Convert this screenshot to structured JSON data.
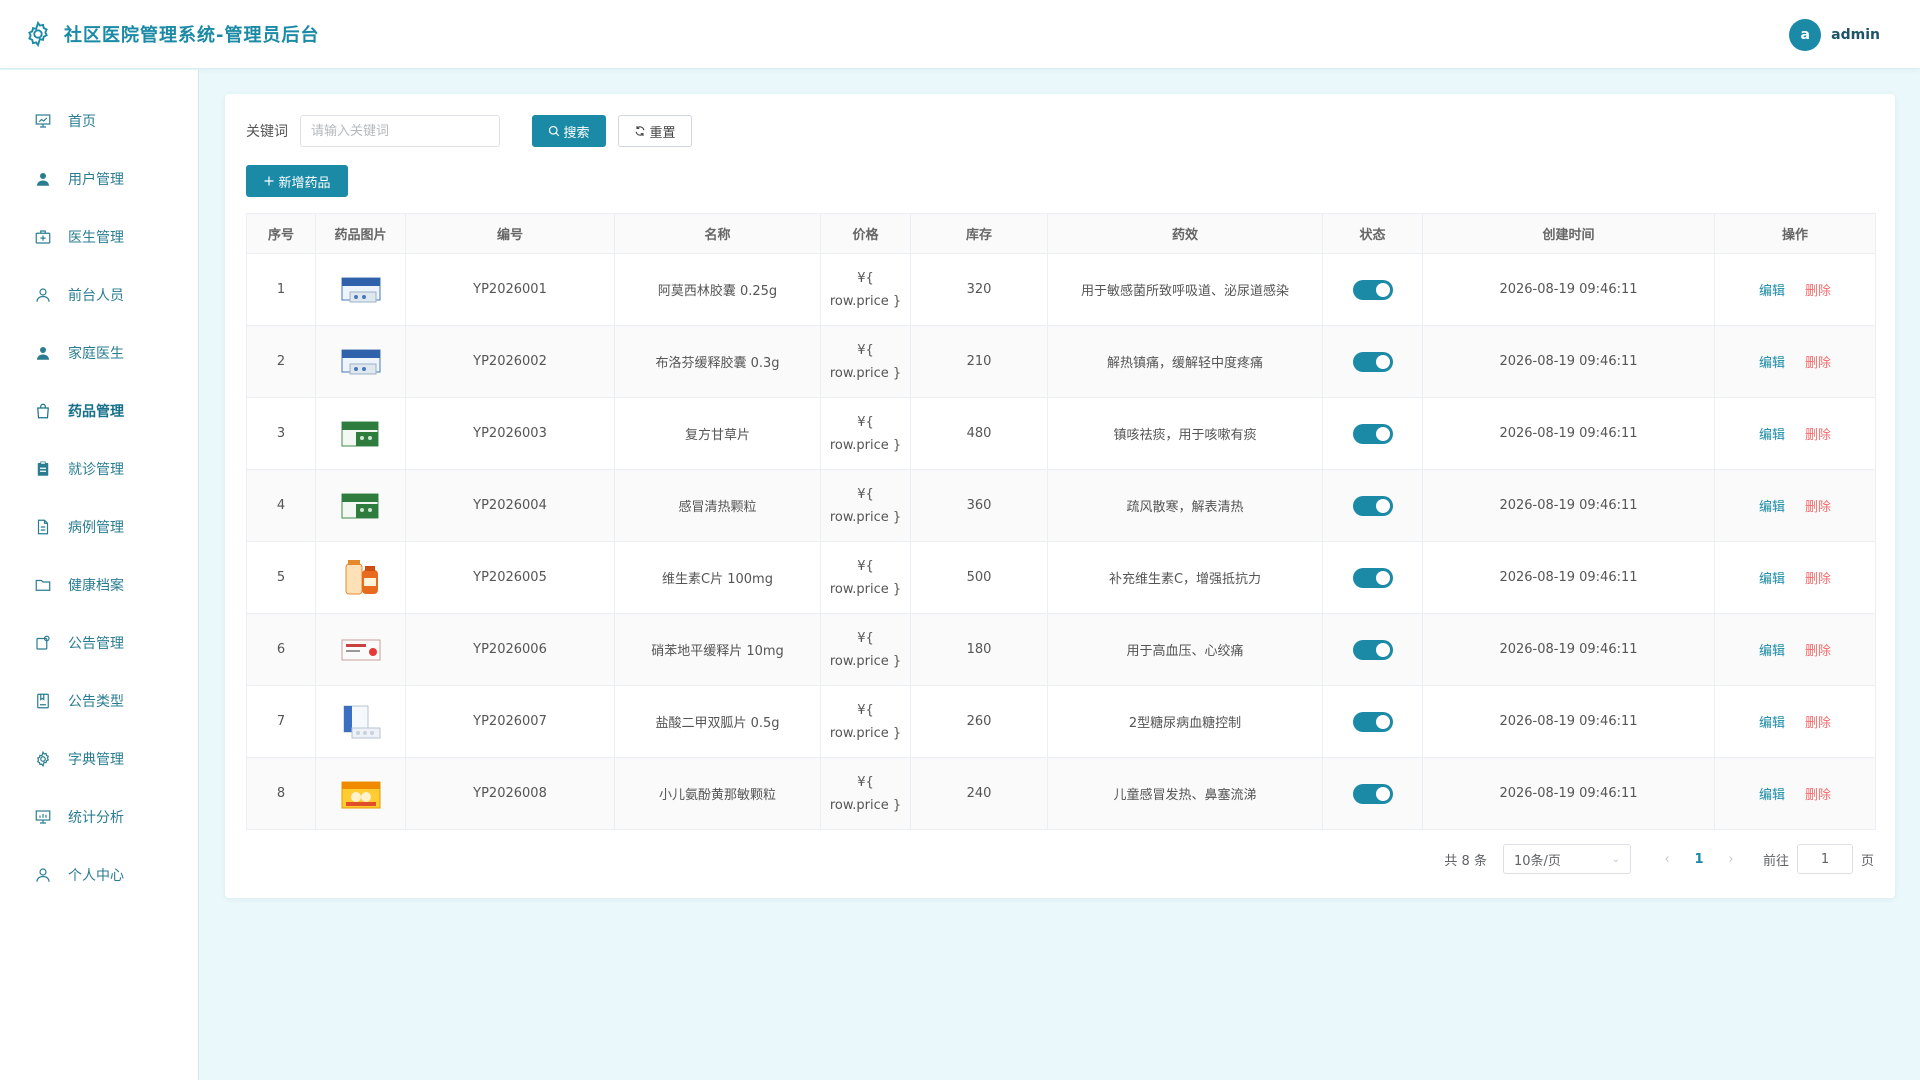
{
  "app": {
    "title": "社区医院管理系统-管理员后台",
    "user_initial": "a",
    "username": "admin",
    "accent_color": "#1a8aa6"
  },
  "sidebar": {
    "items": [
      {
        "label": "首页",
        "icon": "presentation-icon"
      },
      {
        "label": "用户管理",
        "icon": "user-icon"
      },
      {
        "label": "医生管理",
        "icon": "medical-kit-icon"
      },
      {
        "label": "前台人员",
        "icon": "person-outline-icon"
      },
      {
        "label": "家庭医生",
        "icon": "user-icon"
      },
      {
        "label": "药品管理",
        "icon": "shopping-bag-icon",
        "active": true
      },
      {
        "label": "就诊管理",
        "icon": "clipboard-icon"
      },
      {
        "label": "病例管理",
        "icon": "document-icon"
      },
      {
        "label": "健康档案",
        "icon": "folder-icon"
      },
      {
        "label": "公告管理",
        "icon": "notice-icon"
      },
      {
        "label": "公告类型",
        "icon": "notebook-icon"
      },
      {
        "label": "字典管理",
        "icon": "gear-icon"
      },
      {
        "label": "统计分析",
        "icon": "chart-board-icon"
      },
      {
        "label": "个人中心",
        "icon": "person-outline-icon"
      }
    ]
  },
  "search": {
    "label": "关键词",
    "placeholder": "请输入关键词",
    "value": "",
    "search_button": "搜索",
    "reset_button": "重置",
    "add_button": "新增药品"
  },
  "table": {
    "columns": [
      "序号",
      "药品图片",
      "编号",
      "名称",
      "价格",
      "库存",
      "药效",
      "状态",
      "创建时间",
      "操作"
    ],
    "edit_label": "编辑",
    "delete_label": "删除",
    "rows": [
      {
        "index": "1",
        "code": "YP2026001",
        "name": "阿莫西林胶囊 0.25g",
        "price_line1": "¥{",
        "price_line2": "row.price }",
        "stock": "320",
        "effect": "用于敏感菌所致呼吸道、泌尿道感染",
        "status_on": true,
        "created": "2026-08-19 09:46:11",
        "image": "blue-medicine-box"
      },
      {
        "index": "2",
        "code": "YP2026002",
        "name": "布洛芬缓释胶囊 0.3g",
        "price_line1": "¥{",
        "price_line2": "row.price }",
        "stock": "210",
        "effect": "解热镇痛，缓解轻中度疼痛",
        "status_on": true,
        "created": "2026-08-19 09:46:11",
        "image": "blue-medicine-box"
      },
      {
        "index": "3",
        "code": "YP2026003",
        "name": "复方甘草片",
        "price_line1": "¥{",
        "price_line2": "row.price }",
        "stock": "480",
        "effect": "镇咳祛痰，用于咳嗽有痰",
        "status_on": true,
        "created": "2026-08-19 09:46:11",
        "image": "green-medicine-box"
      },
      {
        "index": "4",
        "code": "YP2026004",
        "name": "感冒清热颗粒",
        "price_line1": "¥{",
        "price_line2": "row.price }",
        "stock": "360",
        "effect": "疏风散寒，解表清热",
        "status_on": true,
        "created": "2026-08-19 09:46:11",
        "image": "green-medicine-box"
      },
      {
        "index": "5",
        "code": "YP2026005",
        "name": "维生素C片 100mg",
        "price_line1": "¥{",
        "price_line2": "row.price }",
        "stock": "500",
        "effect": "补充维生素C，增强抵抗力",
        "status_on": true,
        "created": "2026-08-19 09:46:11",
        "image": "orange-bottle"
      },
      {
        "index": "6",
        "code": "YP2026006",
        "name": "硝苯地平缓释片 10mg",
        "price_line1": "¥{",
        "price_line2": "row.price }",
        "stock": "180",
        "effect": "用于高血压、心绞痛",
        "status_on": true,
        "created": "2026-08-19 09:46:11",
        "image": "red-white-box"
      },
      {
        "index": "7",
        "code": "YP2026007",
        "name": "盐酸二甲双胍片 0.5g",
        "price_line1": "¥{",
        "price_line2": "row.price }",
        "stock": "260",
        "effect": "2型糖尿病血糖控制",
        "status_on": true,
        "created": "2026-08-19 09:46:11",
        "image": "white-blister-box"
      },
      {
        "index": "8",
        "code": "YP2026008",
        "name": "小儿氨酚黄那敏颗粒",
        "price_line1": "¥{",
        "price_line2": "row.price }",
        "stock": "240",
        "effect": "儿童感冒发热、鼻塞流涕",
        "status_on": true,
        "created": "2026-08-19 09:46:11",
        "image": "orange-yellow-box"
      }
    ]
  },
  "pagination": {
    "total_text": "共 8 条",
    "page_size": "10条/页",
    "current_page": "1",
    "goto_label": "前往",
    "goto_value": "1",
    "page_suffix": "页"
  }
}
